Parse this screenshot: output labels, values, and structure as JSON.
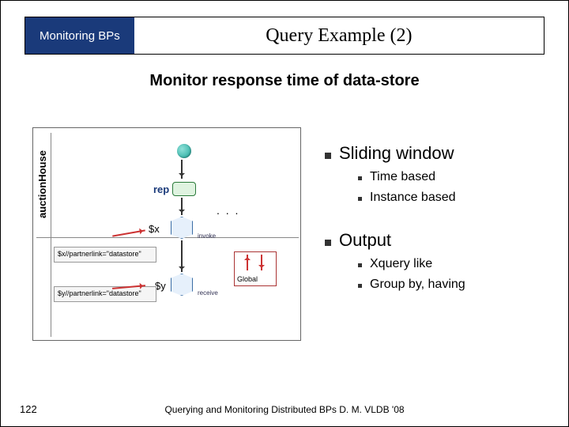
{
  "header": {
    "badge": "Monitoring  BPs",
    "title": "Query Example (2)"
  },
  "subtitle": "Monitor response time of data-store",
  "diagram": {
    "swimlane": "auctionHouse",
    "rep": "rep",
    "dots": ". . .",
    "var_x": "$x",
    "var_y": "$y",
    "invoke": "invoke",
    "receive": "receive",
    "xpath1": "$x//partnerlink=\"datastore\"",
    "xpath2": "$y//partnerlink=\"datastore\"",
    "global": "Global"
  },
  "bullets": {
    "items": [
      {
        "label": "Sliding window",
        "sub": [
          "Time based",
          "Instance based"
        ]
      },
      {
        "label": "Output",
        "sub": [
          "Xquery like",
          "Group by, having"
        ]
      }
    ]
  },
  "page": "122",
  "footer": "Querying and Monitoring Distributed BPs D. M. VLDB '08"
}
